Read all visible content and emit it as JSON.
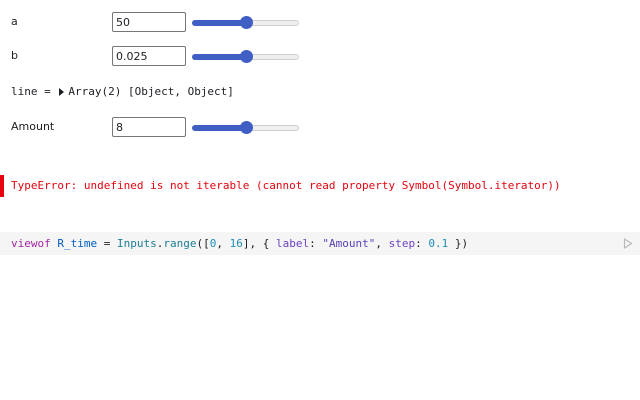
{
  "inputs": {
    "a": {
      "label": "a",
      "value": "50",
      "range_fraction": 0.5
    },
    "b": {
      "label": "b",
      "value": "0.025",
      "range_fraction": 0.5
    },
    "amount": {
      "label": "Amount",
      "value": "8",
      "range_fraction": 0.5
    }
  },
  "line_output": {
    "prefix": "line = ",
    "value": "Array(2) [Object, Object]"
  },
  "error": {
    "message": "TypeError: undefined is not iterable (cannot read property Symbol(Symbol.iterator))"
  },
  "code_cell": {
    "tokens": {
      "kw": "viewof",
      "name": "R_time",
      "eq": " = ",
      "obj": "Inputs",
      "dot": ".",
      "fn": "range",
      "open": "([",
      "n0": "0",
      "comma1": ", ",
      "n16": "16",
      "close_arr": "], { ",
      "label_key": "label",
      "colon1": ": ",
      "label_val": "\"Amount\"",
      "comma2": ", ",
      "step_key": "step",
      "colon2": ": ",
      "step_val": "0.1",
      "close": " })"
    },
    "run_icon": "play-icon"
  },
  "colors": {
    "slider_accent": "#3f5fc4",
    "error": "#e7040f",
    "code_bg": "#f5f5f5"
  }
}
